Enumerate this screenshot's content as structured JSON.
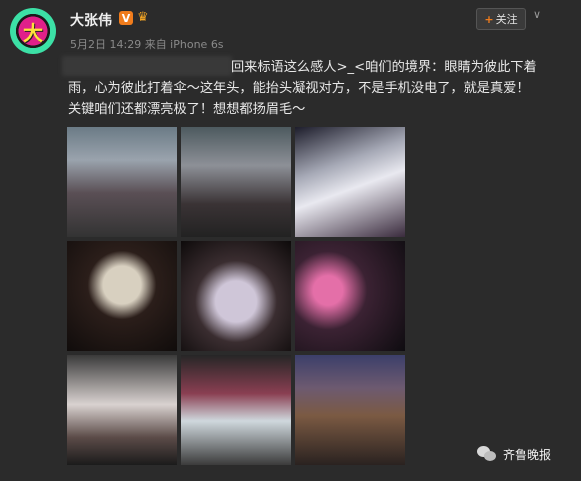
{
  "user": {
    "avatar_char": "大",
    "name": "大张伟",
    "verified_badge": "V",
    "meta": "5月2日 14:29 来自 iPhone 6s"
  },
  "actions": {
    "follow_plus": "+",
    "follow_label": "关注",
    "menu_icon": "chevron-down-icon"
  },
  "post": {
    "line1": "回来标语这么感人>_<咱们的境界：眼睛为彼此下着",
    "line2": "雨，心为彼此打着伞～这年头，能抬头凝视对方，不是手机没电了，就是真爱！",
    "line3": "关键咱们还都漂亮极了！想想都扬眉毛～"
  },
  "watermark": {
    "icon": "wechat-icon",
    "label": "齐鲁晚报"
  },
  "colors": {
    "background": "#2b2b2b",
    "accent": "#f07c1c"
  }
}
